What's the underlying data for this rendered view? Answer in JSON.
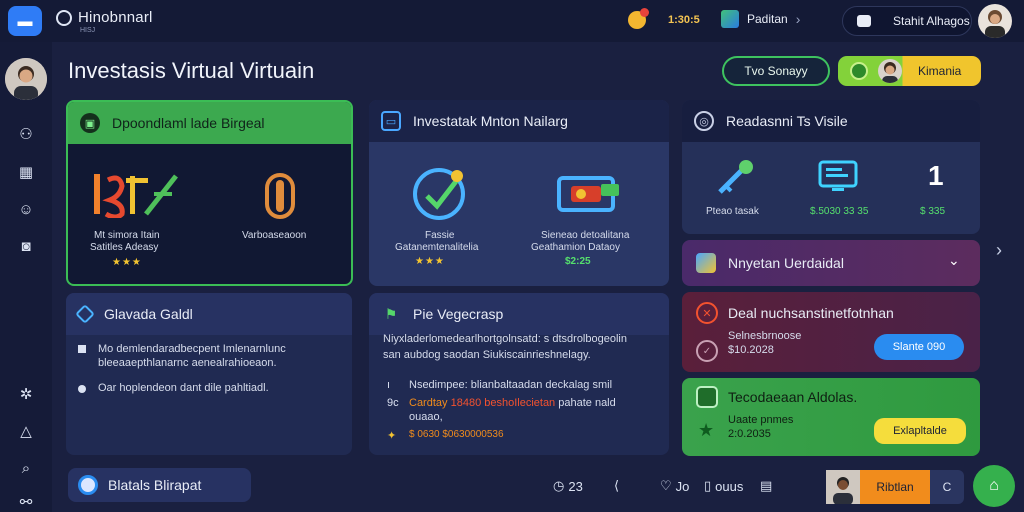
{
  "topbar": {
    "brand": "Hinobnnarl",
    "brand_sub": "HISJ",
    "coin_value": "1:30:5",
    "crumb": "Paditan",
    "user_name": "Stahit Alhagos"
  },
  "page": {
    "title": "Investasis Virtual Virtuain",
    "btn_outline": "Tvo Sonayy",
    "btn_yellow": "Kimania"
  },
  "card1": {
    "header": "Dpoondlaml lade Birgeal",
    "left_line1": "Mt simora Itain",
    "left_line2": "Satitles Adeasy",
    "left_stars": "★★★",
    "right_label": "Varboaseaoon"
  },
  "card2": {
    "header": "Investatak Mnton Nailarg",
    "left_line1": "Fassie",
    "left_line2": "Gatanemtenalitelia",
    "left_stars": "★★★",
    "right_line1": "Sieneao detoalitana",
    "right_line2": "Geathamion Dataoy",
    "right_value": "$2:25"
  },
  "card3": {
    "header": "Readasnni Ts Visile",
    "item1_label": "Pteao tasak",
    "item2_value": "$.5030 33 35",
    "item3_num": "1",
    "item3_value": "$ 335"
  },
  "card4": {
    "header": "Glavada Galdl",
    "line1": "Mo demlendaradbecpent Imlenarnlunc",
    "line2": "bleeaaepthlanarnc aenealrahioeaon.",
    "line3": "Oar hoplendeon dant dile pahltiadl."
  },
  "card5": {
    "header": "Pie Vegecrasp",
    "para1": "Niyxladerlomedearlhortgolnsatd: s dtsdrolbogeolin",
    "para2": "san aubdog saodan Siukiscainrieshnelagy.",
    "item1": "Nsedimpee: blianbaltaadan deckalag smil",
    "item2_prefix": "Cardtay",
    "item2_highlight": "18480 beshoIlecietan",
    "item2_suffix": "pahate nald",
    "item2_cont": "ouaao,",
    "item3": "$ 0630 $0630000536"
  },
  "card6": {
    "label": "Nnyetan Uerdaidal"
  },
  "card7": {
    "title": "Deal nuchsanstinetfotnhan",
    "line1": "Selnesbrnoose",
    "line2": "$10.2028",
    "button": "Slante 090"
  },
  "card8": {
    "title": "Tecodaeaan Aldolas.",
    "line1": "Uaate pnmes",
    "line2": "2:0.2035",
    "button": "Exlapltalde"
  },
  "bottom": {
    "chip": "Blatals Blirapat",
    "icon1_text": "23",
    "icon3_text": "Jo",
    "icon4_text": "ouus",
    "reply_button": "Ribtlan",
    "reply_c": "C"
  },
  "colors": {
    "accent_green": "#3ca94f",
    "accent_blue": "#2a8cf0",
    "accent_yellow": "#f5dd3c",
    "accent_orange": "#f18c1c",
    "background": "#1a2040"
  }
}
